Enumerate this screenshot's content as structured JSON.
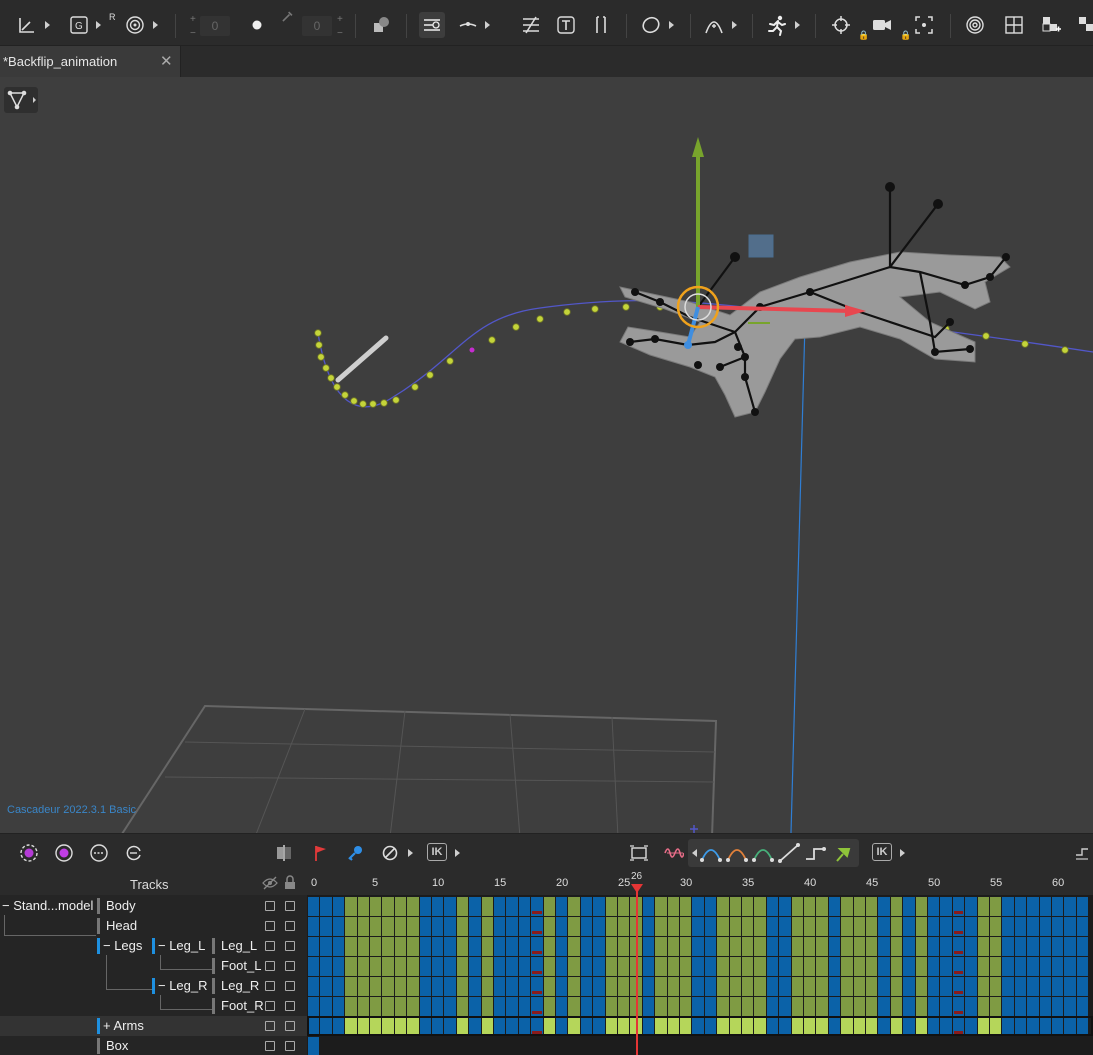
{
  "toolbar": {
    "number_field_1": "0",
    "number_field_2": "0",
    "r_label": "R"
  },
  "tab": {
    "title": "*Backflip_animation",
    "close": "✕"
  },
  "viewport": {
    "version": "Cascadeur 2022.3.1 Basic"
  },
  "bottom": {
    "ik1": "IK",
    "ik2": "IK",
    "ik3": "IK",
    "current_frame": "26"
  },
  "tracks": {
    "title": "Tracks",
    "rows": [
      {
        "label": "− Stand...model"
      },
      {
        "label": "Body"
      },
      {
        "label": "Head"
      },
      {
        "label": "− Legs"
      },
      {
        "label": "− Leg_L"
      },
      {
        "label": "Leg_L"
      },
      {
        "label": "Foot_L"
      },
      {
        "label": "− Leg_R"
      },
      {
        "label": "Leg_R"
      },
      {
        "label": "Foot_R"
      },
      {
        "label": "+ Arms"
      },
      {
        "label": "Box"
      }
    ]
  },
  "timeline": {
    "ticks": [
      "0",
      "5",
      "10",
      "15",
      "20",
      "25",
      "30",
      "35",
      "40",
      "45",
      "50",
      "55",
      "60"
    ],
    "colors": {
      "key": "#0b62a8",
      "interp": "#7f9b43",
      "arms_interp": "#b5d65a",
      "marker": "#8a1c1c"
    }
  }
}
